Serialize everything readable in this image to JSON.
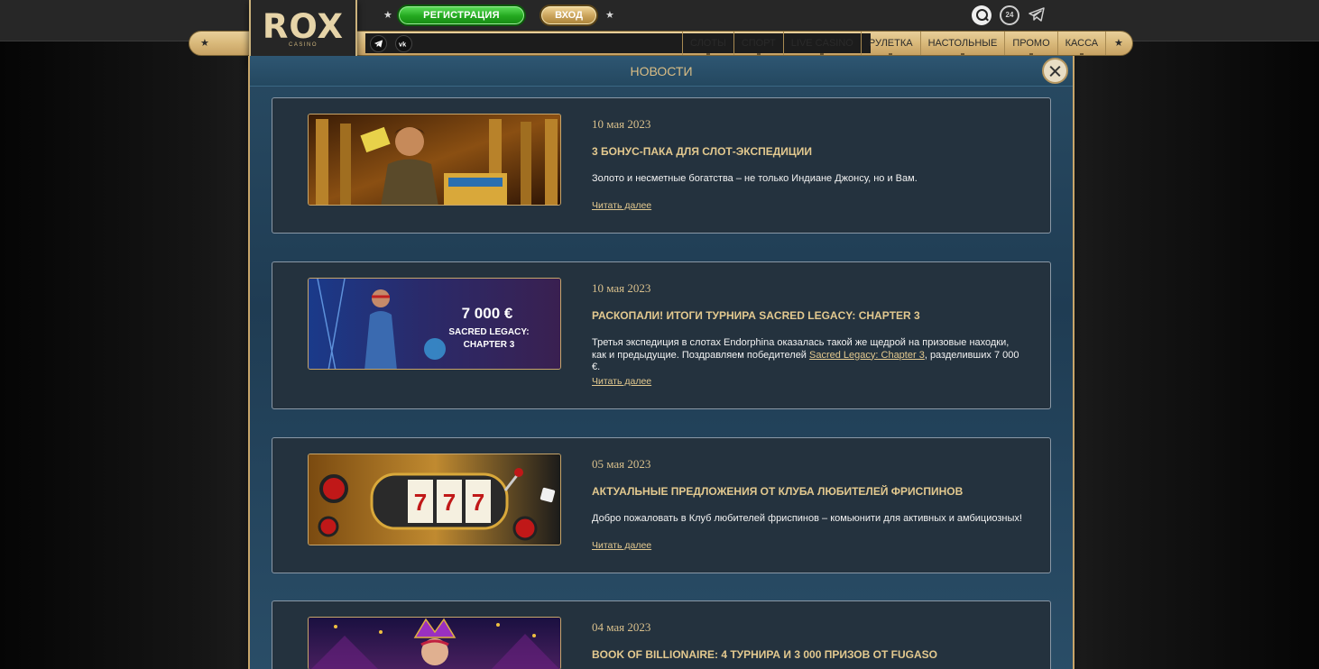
{
  "header": {
    "register_label": "РЕГИСТРАЦИЯ",
    "login_label": "ВХОД",
    "support_label": "24",
    "logo_text": "ROX",
    "logo_sub": "CASINO"
  },
  "nav": {
    "items": [
      "СЛОТЫ",
      "СПОРТ",
      "LIVE CASINO",
      "РУЛЕТКА",
      "НАСТОЛЬНЫЕ",
      "ПРОМО",
      "КАССА"
    ]
  },
  "panel": {
    "title": "НОВОСТИ"
  },
  "news": [
    {
      "date": "10 мая 2023",
      "title": "3 БОНУС-ПАКА ДЛЯ СЛОТ-ЭКСПЕДИЦИИ",
      "text": "Золото и несметные богатства – не только Индиане Джонсу, но и Вам.",
      "read_more": "Читать далее"
    },
    {
      "date": "10 мая 2023",
      "title": "РАСКОПАЛИ! ИТОГИ ТУРНИРА SACRED LEGACY: CHAPTER 3",
      "text_before": "Третья экспедиция в слотах Endorphina оказалась такой же щедрой на призовые находки, как и предыдущие. Поздравляем победителей ",
      "text_link": "Sacred Legacy: Chapter 3",
      "text_after": ", разделивших 7 000 €.",
      "image_amount": "7 000 €",
      "image_caption_1": "SACRED LEGACY:",
      "image_caption_2": "CHAPTER 3",
      "read_more": "Читать далее"
    },
    {
      "date": "05 мая 2023",
      "title": "АКТУАЛЬНЫЕ ПРЕДЛОЖЕНИЯ ОТ КЛУБА ЛЮБИТЕЛЕЙ ФРИСПИНОВ",
      "text": "Добро пожаловать в Клуб любителей фриспинов – комьюнити для активных и амбициозных!",
      "image_digits": [
        "7",
        "7",
        "7"
      ],
      "read_more": "Читать далее"
    },
    {
      "date": "04 мая 2023",
      "title": "BOOK OF BILLIONAIRE: 4 ТУРНИРА И 3 000 ПРИЗОВ ОТ FUGASO"
    }
  ],
  "colors": {
    "accent_gold": "#e3c98f",
    "register_green": "#23a81f",
    "panel_blue": "#284a62",
    "card_bg": "#24323e"
  }
}
